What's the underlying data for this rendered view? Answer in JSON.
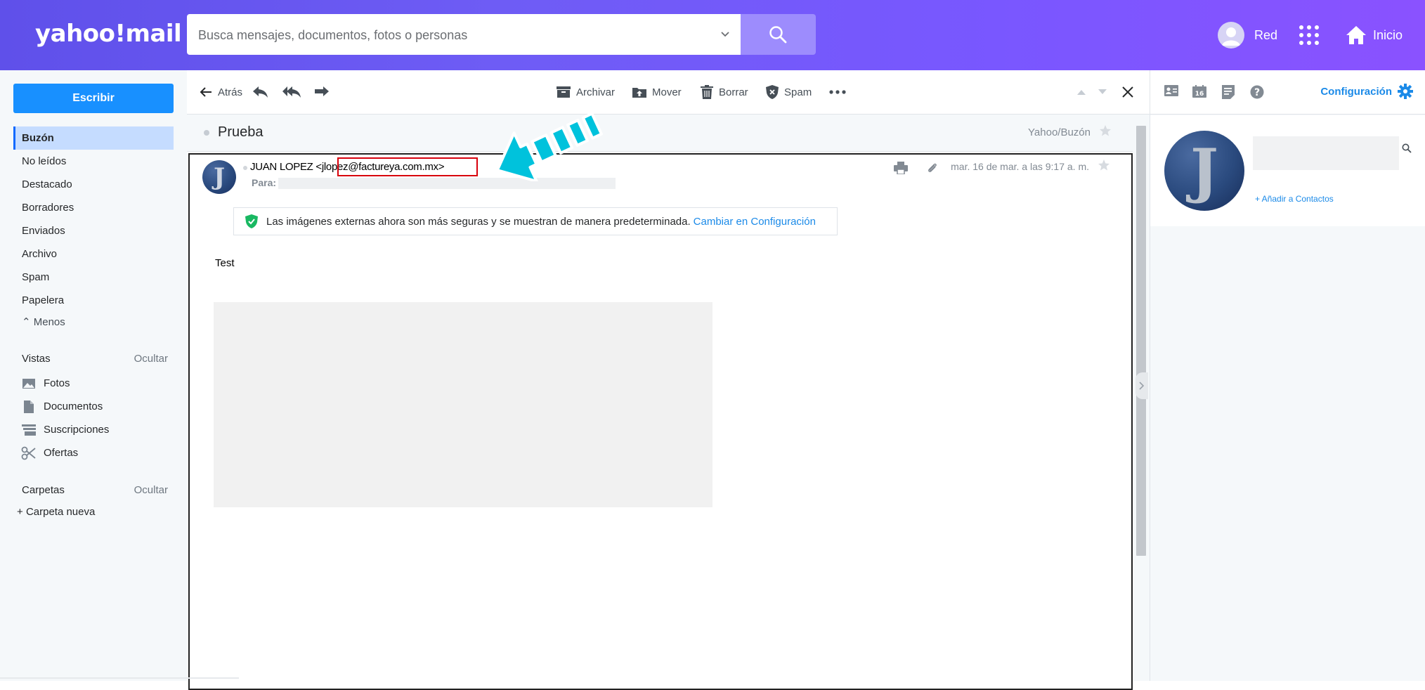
{
  "header": {
    "logo": "yahoo!mail",
    "search_placeholder": "Busca mensajes, documentos, fotos o personas",
    "user_name": "Red",
    "home_label": "Inicio"
  },
  "sidebar": {
    "compose_label": "Escribir",
    "nav_items": [
      "Buzón",
      "No leídos",
      "Destacado",
      "Borradores",
      "Enviados",
      "Archivo",
      "Spam",
      "Papelera"
    ],
    "less_label": "Menos",
    "views_title": "Vistas",
    "views_toggle": "Ocultar",
    "views": [
      {
        "label": "Fotos",
        "icon": "photo-icon"
      },
      {
        "label": "Documentos",
        "icon": "document-icon"
      },
      {
        "label": "Suscripciones",
        "icon": "subscriptions-icon"
      },
      {
        "label": "Ofertas",
        "icon": "scissors-icon"
      }
    ],
    "folders_title": "Carpetas",
    "folders_toggle": "Ocultar",
    "new_folder_label": "Carpeta nueva"
  },
  "toolbar": {
    "back_label": "Atrás",
    "archive_label": "Archivar",
    "move_label": "Mover",
    "delete_label": "Borrar",
    "spam_label": "Spam"
  },
  "message": {
    "subject": "Prueba",
    "folder_path": "Yahoo/Buzón",
    "sender": "JUAN LOPEZ <jlopez@factureya.com.mx>",
    "to_label": "Para:",
    "date": "mar. 16 de mar. a las 9:17 a. m.",
    "notice_text": "Las imágenes externas ahora son más seguras y se muestran de manera predeterminada.",
    "notice_link": "Cambiar en Configuración",
    "body_text": "Test",
    "avatar_letter": "J"
  },
  "right_pane": {
    "settings_label": "Configuración",
    "add_contact_label": "+ Añadir a Contactos",
    "avatar_letter": "J"
  },
  "colors": {
    "header_gradient_start": "#5f50ea",
    "header_gradient_end": "#8a52ff",
    "compose_blue": "#1890ff",
    "link_blue": "#1b8ae8",
    "annotation_arrow": "#00c2dc",
    "highlight_box": "#d8000c"
  }
}
